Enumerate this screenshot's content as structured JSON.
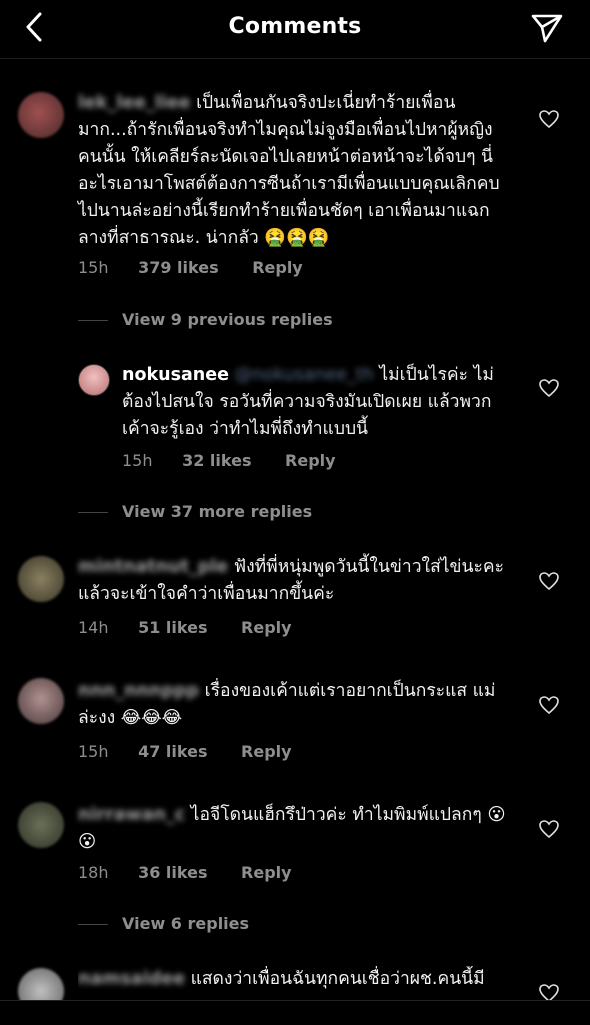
{
  "header": {
    "title": "Comments"
  },
  "comments": [
    {
      "username": "lek_lee_liee",
      "text": "เป็นเพื่อนกันจริงปะเนี่ยทำร้ายเพื่อนมาก...ถ้ารักเพื่อนจริงทำไมคุณไม่จูงมือเพื่อนไปหาผู้หญิงคนนั้น ให้เคลียร์ละนัดเจอไปเลยหน้าต่อหน้าจะได้จบๆ นี่อะไรเอามาโพสต์ต้องการซีนถ้าเรามีเพื่อนแบบคุณเลิกคบไปนานล่ะอย่างนี้เรียกทำร้ายเพื่อนชัดๆ เอาเพื่อนมาแฉกลางที่สาธารณะ. น่ากลัว 🤮🤮🤮",
      "time": "15h",
      "likes": "379 likes",
      "reply": "Reply"
    },
    {
      "view_replies": "View 9 previous replies"
    },
    {
      "username": "nokusanee",
      "mention": "@nokusanee_th",
      "text": "ไม่เป็นไรค่ะ ไม่ต้องไปสนใจ รอวันที่ความจริงมันเปิดเผย แล้วพวกเค้าจะรู้เอง ว่าทำไมพี่ถึงทำแบบนี้",
      "time": "15h",
      "likes": "32 likes",
      "reply": "Reply"
    },
    {
      "view_replies": "View 37 more replies"
    },
    {
      "username": "mintnatnut_ple",
      "text": "ฟังที่พี่หนุ่มพูดวันนี้ในข่าวใส่ไข่นะคะ แล้วจะเข้าใจคำว่าเพื่อนมากขึ้นค่ะ",
      "time": "14h",
      "likes": "51 likes",
      "reply": "Reply"
    },
    {
      "username": "nnn_nnnppp",
      "text": "เรื่องของเค้าแต่เราอยากเป็นกระแส แม่ล่ะงง 😂😂😂",
      "time": "15h",
      "likes": "47 likes",
      "reply": "Reply"
    },
    {
      "username": "nirrawan_c",
      "text": "ไอจีโดนแฮ็กรึป่าวค่ะ ทำไมพิมพ์แปลกๆ 😮😮",
      "time": "18h",
      "likes": "36 likes",
      "reply": "Reply"
    },
    {
      "view_replies": "View 6 replies"
    },
    {
      "username": "namsaidee",
      "text": "แสดงว่าเพื่อนฉันทุกคนเชื่อว่าผช.คนนี้มี"
    }
  ],
  "colors": {
    "background": "#000000",
    "text": "#f2f2f2",
    "muted": "#8e8e8e",
    "avatar1": "#7a4a4a",
    "avatar2": "#c98a8a",
    "avatar3": "#6b6450",
    "avatar4": "#8a7a7a",
    "avatar5": "#5c6650",
    "avatar6": "#8a8a8a"
  },
  "icons": [
    "back-chevron-icon",
    "send-icon",
    "heart-icon"
  ]
}
